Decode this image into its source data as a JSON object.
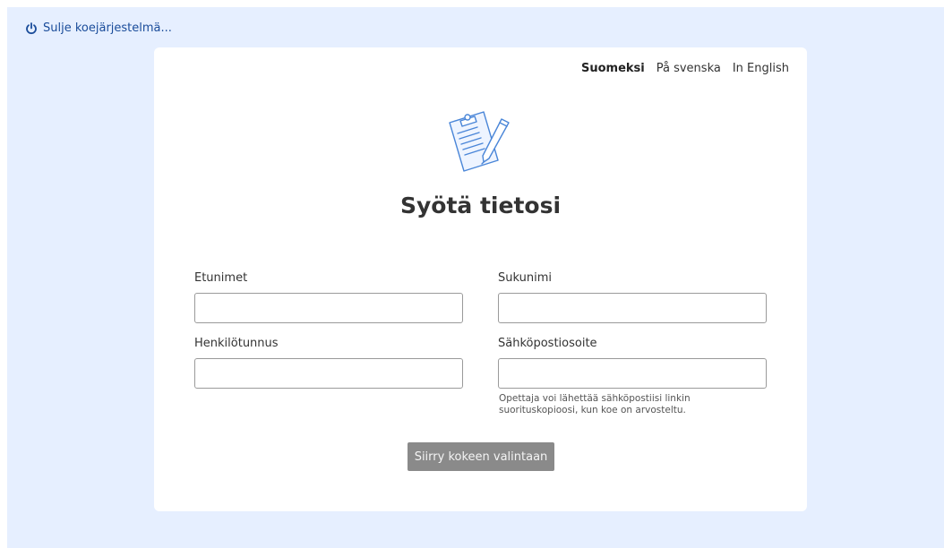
{
  "top_action": {
    "label": "Sulje koejärjestelmä..."
  },
  "languages": [
    {
      "label": "Suomeksi"
    },
    {
      "label": "På svenska"
    },
    {
      "label": "In English"
    }
  ],
  "form": {
    "title": "Syötä tietosi",
    "first_names": {
      "label": "Etunimet",
      "value": ""
    },
    "last_name": {
      "label": "Sukunimi",
      "value": ""
    },
    "ssn": {
      "label": "Henkilötunnus",
      "value": ""
    },
    "email": {
      "label": "Sähköpostiosoite",
      "value": "",
      "hint": "Opettaja voi lähettää sähköpostiisi linkin suorituskopioosi, kun koe on arvosteltu."
    },
    "submit_label": "Siirry kokeen valintaan"
  },
  "colors": {
    "background": "#e6efff",
    "link": "#1a4c9a",
    "illustration": "#4a86d8",
    "button_disabled": "#8a8a8a"
  }
}
